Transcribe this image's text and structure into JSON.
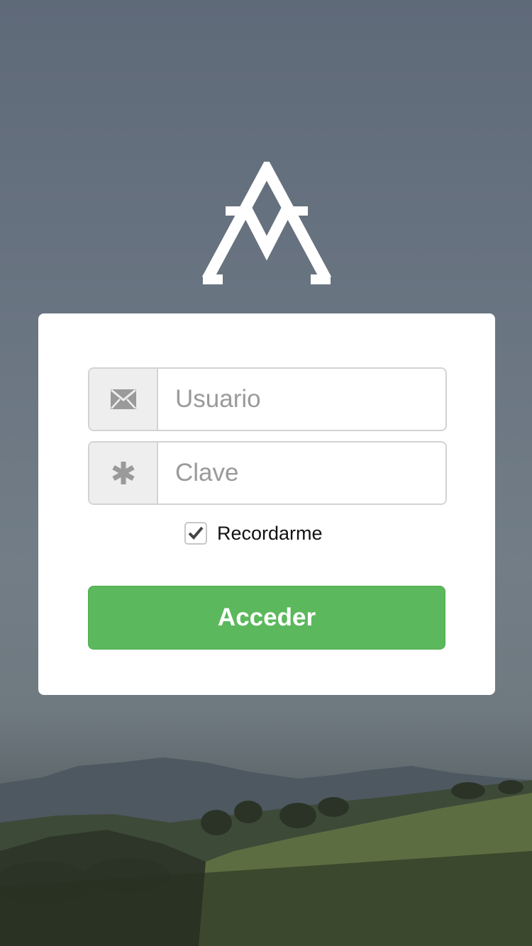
{
  "login": {
    "username_placeholder": "Usuario",
    "username_icon": "envelope-icon",
    "password_placeholder": "Clave",
    "password_icon": "asterisk-icon",
    "remember_label": "Recordarme",
    "remember_checked": true,
    "submit_label": "Acceder"
  },
  "colors": {
    "primary_button": "#5cb85c",
    "card_background": "#ffffff",
    "addon_background": "#eeeeee"
  }
}
